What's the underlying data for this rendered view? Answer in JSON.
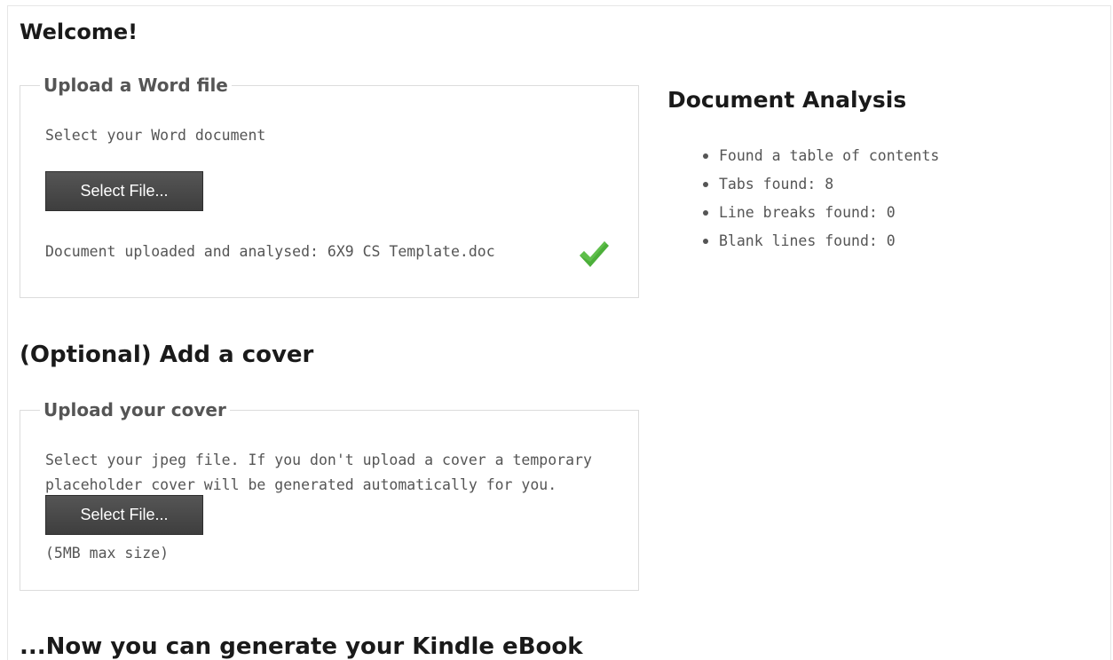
{
  "welcome": {
    "heading": "Welcome!"
  },
  "word_upload": {
    "legend": "Upload a Word file",
    "instruction": "Select your Word document",
    "button_label": "Select File...",
    "status": "Document uploaded and analysed: 6X9 CS Template.doc",
    "status_icon": "checkmark-icon",
    "status_color": "#4caf3a"
  },
  "analysis": {
    "heading": "Document Analysis",
    "items": [
      "Found a table of contents",
      "Tabs found: 8",
      "Line breaks found: 0",
      "Blank lines found: 0"
    ]
  },
  "cover": {
    "heading": "(Optional) Add a cover",
    "legend": "Upload your cover",
    "instruction_line1": "Select your jpeg file. If you don't upload a cover a temporary",
    "instruction_line2": "placeholder cover will be generated automatically for you.",
    "button_label": "Select File...",
    "size_note": "(5MB max size)"
  },
  "generate": {
    "heading": "...Now you can generate your Kindle eBook"
  },
  "colors": {
    "button_bg": "#474747",
    "heading_text": "#1a1a1a",
    "body_text": "#555555",
    "border": "#dcdcdc"
  }
}
